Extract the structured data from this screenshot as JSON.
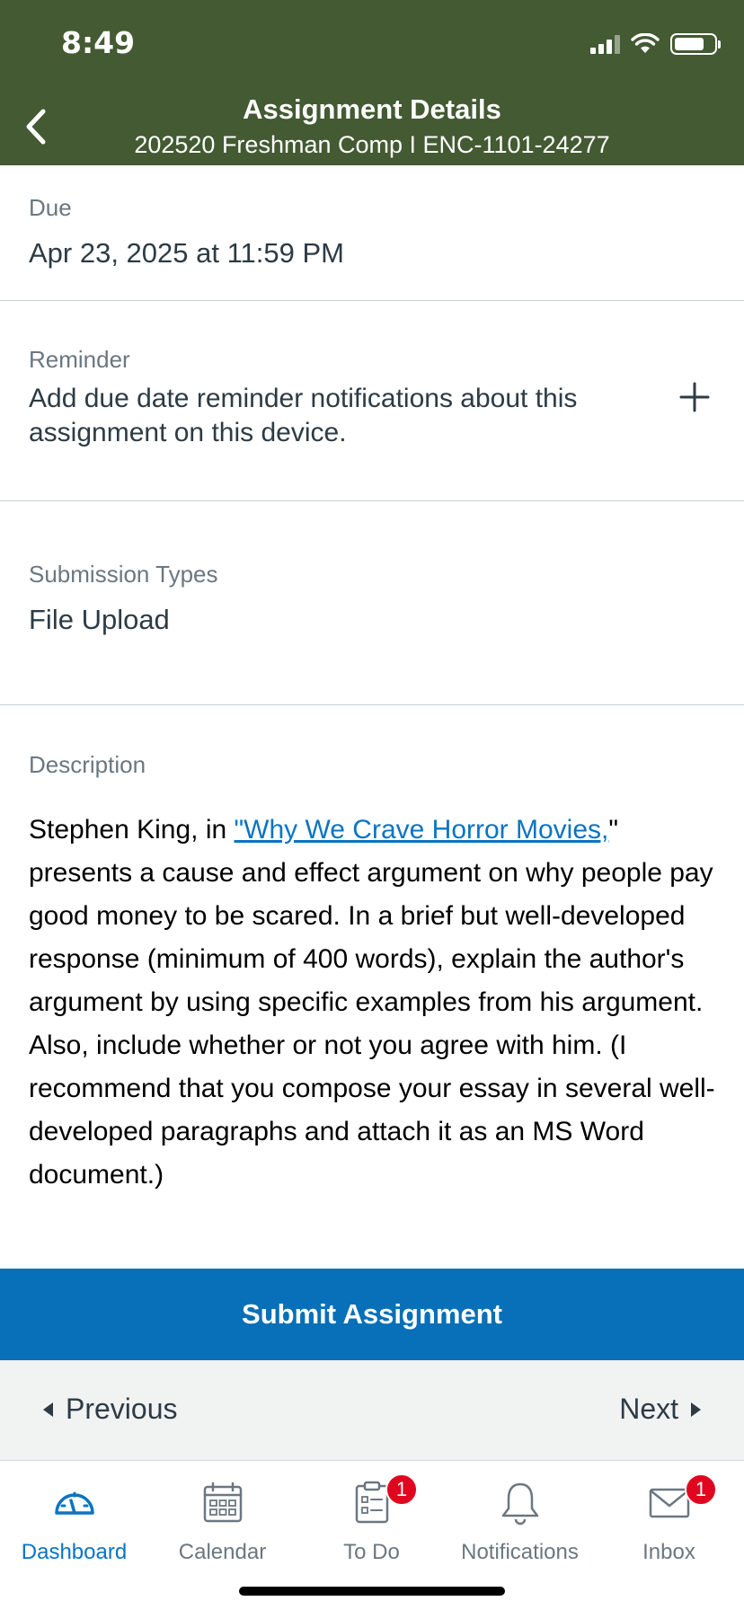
{
  "status_bar": {
    "time": "8:49"
  },
  "header": {
    "title": "Assignment Details",
    "subtitle": "202520 Freshman Comp I ENC-1101-24277",
    "background_color": "#435a32"
  },
  "due": {
    "label": "Due",
    "value": "Apr 23, 2025 at 11:59 PM"
  },
  "reminder": {
    "label": "Reminder",
    "line1": "Add due date reminder notifications about this",
    "line2": "assignment on this device."
  },
  "submission_types": {
    "label": "Submission Types",
    "value": "File Upload"
  },
  "description": {
    "label": "Description",
    "prefix": "Stephen King, in ",
    "link_text": "\"Why We Crave Horror Movies,",
    "suffix": "\" presents a cause and effect argument on why people pay good money to be scared. In a brief but well-developed response (minimum of 400 words), explain the author's argument by using specific examples from his argument. Also, include whether or not you agree with him. (I recommend that you compose your essay in several well-developed paragraphs and attach it as an MS Word document.)",
    "link_color": "#0b74c3"
  },
  "submit_button": {
    "label": "Submit Assignment",
    "color": "#0770b8"
  },
  "pager": {
    "previous": "Previous",
    "next": "Next"
  },
  "tabs": [
    {
      "label": "Dashboard",
      "icon": "dashboard-icon",
      "active": true
    },
    {
      "label": "Calendar",
      "icon": "calendar-icon"
    },
    {
      "label": "To Do",
      "icon": "todo-icon",
      "badge": "1"
    },
    {
      "label": "Notifications",
      "icon": "bell-icon"
    },
    {
      "label": "Inbox",
      "icon": "inbox-icon",
      "badge": "1"
    }
  ]
}
